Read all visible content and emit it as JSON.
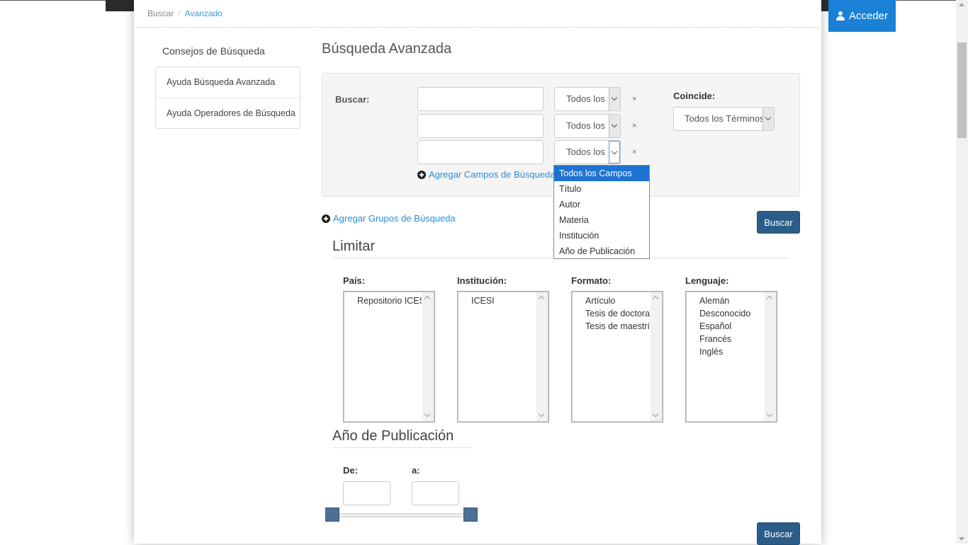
{
  "header": {
    "login_label": "Acceder"
  },
  "breadcrumb": {
    "home": "Buscar",
    "separator": "/",
    "current": "Avanzado"
  },
  "sidebar": {
    "title": "Consejos de Búsqueda",
    "items": [
      {
        "label": "Ayuda Búsqueda Avanzada"
      },
      {
        "label": "Ayuda Operadores de Búsqueda"
      }
    ]
  },
  "main": {
    "title": "Búsqueda Avanzada",
    "search_group": {
      "label": "Buscar:",
      "rows": [
        {
          "value": "",
          "field": "Todos los",
          "remove": "×"
        },
        {
          "value": "",
          "field": "Todos los",
          "remove": "×"
        },
        {
          "value": "",
          "field": "Todos los",
          "remove": "×"
        }
      ],
      "add_fields": "Agregar Campos de Búsqueda",
      "match_label": "Coincide:",
      "match_value": "Todos los Términos"
    },
    "add_groups": "Agregar Grupos de Búsqueda",
    "search_button": "Buscar",
    "field_dropdown": {
      "selected_index": 0,
      "options": [
        "Todos los Campos",
        "Título",
        "Autor",
        "Materia",
        "Institución",
        "Año de Publicación"
      ]
    },
    "limit": {
      "title": "Limitar",
      "facets": [
        {
          "label": "País:",
          "options": [
            "Repositorio ICESI"
          ]
        },
        {
          "label": "Institución:",
          "options": [
            "ICESI"
          ]
        },
        {
          "label": "Formato:",
          "options": [
            "Artículo",
            "Tesis de doctorado",
            "Tesis de maestría"
          ]
        },
        {
          "label": "Lenguaje:",
          "options": [
            "Alemán",
            "Desconocido",
            "Español",
            "Francés",
            "Inglés"
          ]
        }
      ]
    },
    "year": {
      "title": "Año de Publicación",
      "from_label": "De:",
      "to_label": "a:",
      "from_value": "",
      "to_value": ""
    },
    "bottom_button": "Buscar"
  },
  "colors": {
    "accent": "#1a81d6",
    "button": "#2c5d8a",
    "link": "#2a8dd4",
    "selected": "#1e73d2"
  }
}
